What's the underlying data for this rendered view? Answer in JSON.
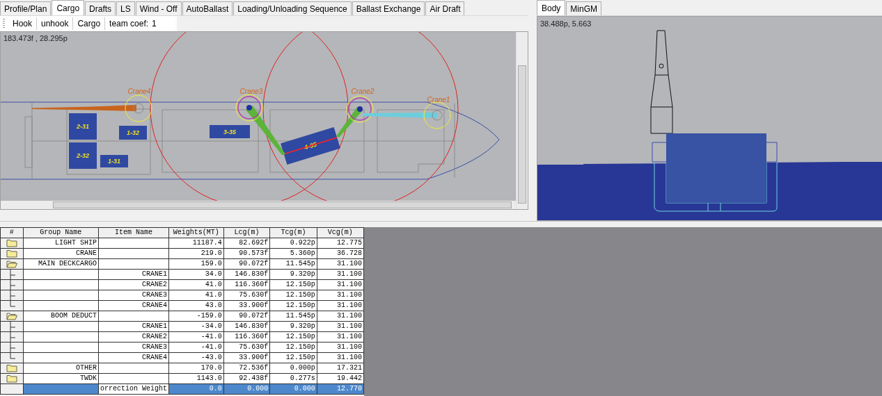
{
  "tabs": [
    {
      "label": "Profile/Plan",
      "selected": false
    },
    {
      "label": "Cargo",
      "selected": true
    },
    {
      "label": "Drafts",
      "selected": false
    },
    {
      "label": "LS",
      "selected": false
    },
    {
      "label": "Wind - Off",
      "selected": false
    },
    {
      "label": "AutoBallast",
      "selected": false
    },
    {
      "label": "Loading/Unloading Sequence",
      "selected": false
    },
    {
      "label": "Ballast Exchange",
      "selected": false
    },
    {
      "label": "Air Draft",
      "selected": false
    }
  ],
  "toolbar": {
    "buttons": [
      "Hook",
      "unhook",
      "Cargo"
    ],
    "coef_label": "team coef:",
    "coef_value": "1"
  },
  "plan": {
    "coordinates": "183.473f , 28.295p",
    "cranes": [
      {
        "label": "Crane4",
        "color": "#c8641e",
        "hooked": false
      },
      {
        "label": "Crane3",
        "color": "#5cb43a",
        "hooked": true
      },
      {
        "label": "Crane2",
        "color": "#5cb43a",
        "hooked": true
      },
      {
        "label": "Crane1",
        "color": "#6ccedc",
        "hooked": false
      }
    ],
    "cargo": [
      {
        "label": "2-31"
      },
      {
        "label": "2-32"
      },
      {
        "label": "1-32"
      },
      {
        "label": "1-31"
      },
      {
        "label": "3-35"
      },
      {
        "label": "4-35"
      }
    ]
  },
  "side_tabs": [
    {
      "label": "Body",
      "selected": true
    },
    {
      "label": "MinGM",
      "selected": false
    }
  ],
  "section": {
    "coordinates": "38.488p, 5.663"
  },
  "table": {
    "columns": [
      "#",
      "Group Name",
      "Item Name",
      "Weights(MT)",
      "Lcg(m)",
      "Tcg(m)",
      "Vcg(m)"
    ],
    "rows": [
      {
        "kind": "group",
        "group": "LIGHT SHIP",
        "expanded": false,
        "selected": false,
        "weight": "11187.4",
        "lcg": "82.692f",
        "tcg": "0.922p",
        "vcg": "12.775"
      },
      {
        "kind": "group",
        "group": "CRANE",
        "expanded": false,
        "selected": false,
        "weight": "219.0",
        "lcg": "90.573f",
        "tcg": "5.360p",
        "vcg": "36.728"
      },
      {
        "kind": "group",
        "group": "MAIN DECKCARGO",
        "expanded": true,
        "selected": false,
        "weight": "159.0",
        "lcg": "90.072f",
        "tcg": "11.545p",
        "vcg": "31.100",
        "children": [
          {
            "item": "CRANE1",
            "selected": false,
            "weight": "34.0",
            "lcg": "146.830f",
            "tcg": "9.320p",
            "vcg": "31.100"
          },
          {
            "item": "CRANE2",
            "selected": false,
            "weight": "41.0",
            "lcg": "116.360f",
            "tcg": "12.150p",
            "vcg": "31.100"
          },
          {
            "item": "CRANE3",
            "selected": false,
            "weight": "41.0",
            "lcg": "75.630f",
            "tcg": "12.150p",
            "vcg": "31.100"
          },
          {
            "item": "CRANE4",
            "selected": false,
            "weight": "43.0",
            "lcg": "33.900f",
            "tcg": "12.150p",
            "vcg": "31.100"
          }
        ]
      },
      {
        "kind": "group",
        "group": "BOOM DEDUCT",
        "expanded": true,
        "selected": false,
        "weight": "-159.0",
        "lcg": "90.072f",
        "tcg": "11.545p",
        "vcg": "31.100",
        "children": [
          {
            "item": "CRANE1",
            "selected": false,
            "weight": "-34.0",
            "lcg": "146.830f",
            "tcg": "9.320p",
            "vcg": "31.100"
          },
          {
            "item": "CRANE2",
            "selected": false,
            "weight": "-41.0",
            "lcg": "116.360f",
            "tcg": "12.150p",
            "vcg": "31.100"
          },
          {
            "item": "CRANE3",
            "selected": false,
            "weight": "-41.0",
            "lcg": "75.630f",
            "tcg": "12.150p",
            "vcg": "31.100"
          },
          {
            "item": "CRANE4",
            "selected": false,
            "weight": "-43.0",
            "lcg": "33.900f",
            "tcg": "12.150p",
            "vcg": "31.100"
          }
        ]
      },
      {
        "kind": "group",
        "group": "OTHER",
        "expanded": false,
        "selected": false,
        "weight": "170.0",
        "lcg": "72.536f",
        "tcg": "0.000p",
        "vcg": "17.321"
      },
      {
        "kind": "group",
        "group": "TWDK",
        "expanded": false,
        "selected": false,
        "weight": "1143.0",
        "lcg": "92.438f",
        "tcg": "0.277s",
        "vcg": "19.442"
      },
      {
        "kind": "summary",
        "item": "orrection Weight",
        "selected": true,
        "weight": "0.0",
        "lcg": "0.000",
        "tcg": "0.000",
        "vcg": "12.770"
      }
    ]
  }
}
